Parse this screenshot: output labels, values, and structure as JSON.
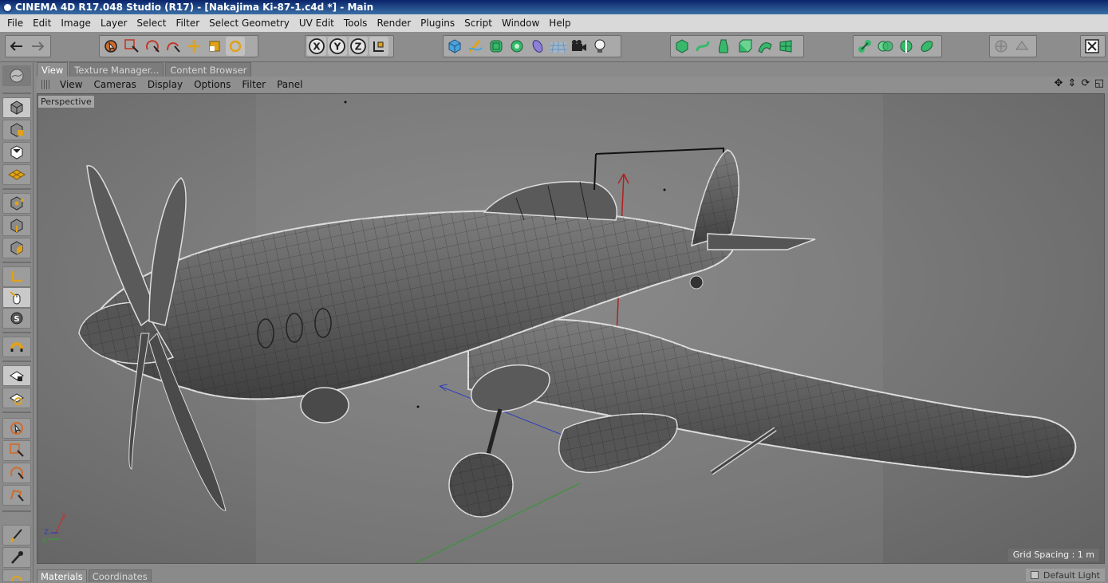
{
  "window": {
    "title": "CINEMA 4D R17.048 Studio (R17) - [Nakajima Ki-87-1.c4d *] - Main"
  },
  "menubar": [
    "File",
    "Edit",
    "Image",
    "Layer",
    "Select",
    "Filter",
    "Select Geometry",
    "UV Edit",
    "Tools",
    "Render",
    "Plugins",
    "Script",
    "Window",
    "Help"
  ],
  "toolbar": {
    "axis_labels": [
      "X",
      "Y",
      "Z"
    ]
  },
  "panel_tabs": [
    "View",
    "Texture Manager...",
    "Content Browser"
  ],
  "view_menu": [
    "View",
    "Cameras",
    "Display",
    "Options",
    "Filter",
    "Panel"
  ],
  "viewport": {
    "camera_label": "Perspective",
    "grid_spacing": "Grid Spacing : 1 m",
    "axis_gizmo": {
      "x": "X",
      "y": "Y",
      "z": "Z"
    }
  },
  "bottom_tabs": [
    "Materials",
    "Coordinates"
  ],
  "status": {
    "default_light": "Default Light"
  },
  "colors": {
    "titlebar": "#0a246a",
    "menubar": "#d9d9d9",
    "panel": "#8a8a8a",
    "accent_orange": "#e0a21a",
    "accent_green": "#37b86b",
    "accent_blue": "#4aa3df"
  },
  "icons": {
    "toolbar": [
      "undo-icon",
      "redo-icon",
      "live-selection-icon",
      "rectangle-select-icon",
      "rotate-icon",
      "scale-icon",
      "move-icon",
      "cube-scale-icon",
      "refresh-icon",
      "x-lock-icon",
      "y-lock-icon",
      "z-lock-icon",
      "coordinate-system-icon",
      "cube-icon",
      "pen-icon",
      "subdivision-icon",
      "array-icon",
      "deformer-icon",
      "floor-icon",
      "camera-icon",
      "light-icon",
      "cube-green-icon",
      "spline-green-icon",
      "lathe-icon",
      "extrude-icon",
      "sweep-icon",
      "loft-icon",
      "connect-icon",
      "boole-icon",
      "symmetry-icon",
      "metaball-icon",
      "render-region-icon",
      "render-settings-icon",
      "fullscreen-icon"
    ],
    "leftbar": [
      "model-mode-icon",
      "object-mode-icon",
      "texture-mode-icon",
      "workplane-icon",
      "points-mode-icon",
      "edges-mode-icon",
      "polygons-mode-icon",
      "axis-icon",
      "tweak-icon",
      "solo-icon",
      "snap-icon",
      "lock-workplane-icon",
      "magnet-icon",
      "live-select-icon",
      "box-select-icon",
      "lasso-select-icon",
      "polygon-select-icon",
      "brush-icon",
      "eyedropper-icon",
      "knife-icon"
    ]
  }
}
